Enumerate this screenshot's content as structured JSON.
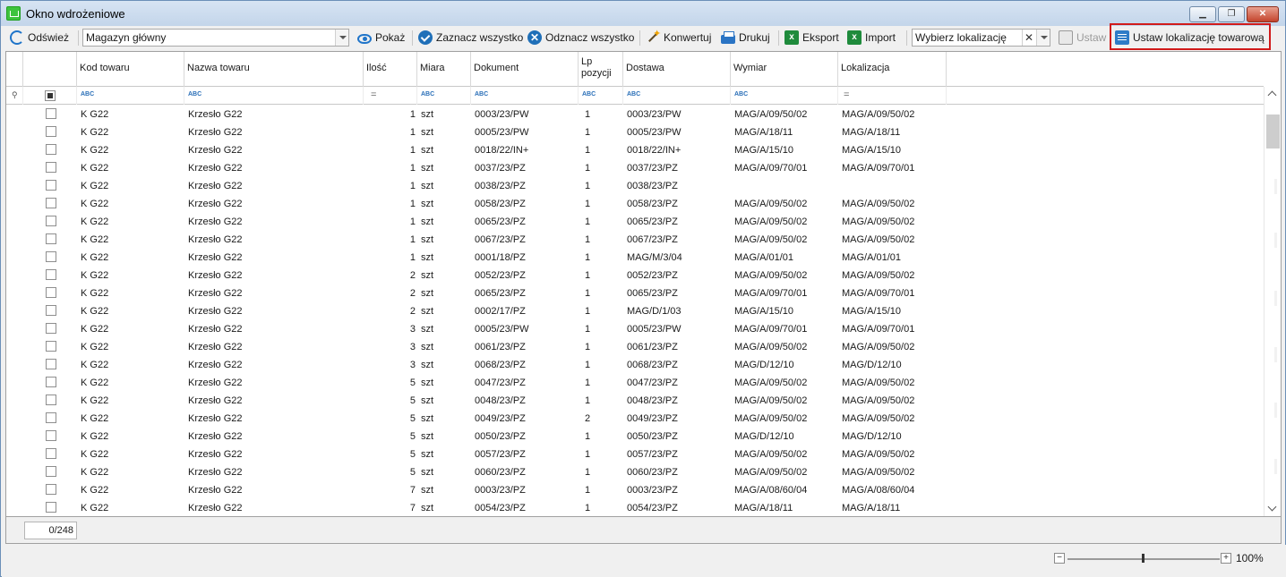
{
  "window": {
    "title": "Okno wdrożeniowe"
  },
  "toolbar": {
    "refresh_label": "Odśwież",
    "warehouse_value": "Magazyn główny",
    "show_label": "Pokaż",
    "select_all_label": "Zaznacz wszystko",
    "deselect_all_label": "Odznacz wszystko",
    "convert_label": "Konwertuj",
    "print_label": "Drukuj",
    "export_label": "Eksport",
    "import_label": "Import",
    "location_placeholder": "Wybierz lokalizację",
    "set_label": "Ustaw",
    "set_location_label": "Ustaw lokalizację towarową",
    "clear_glyph": "✕"
  },
  "grid": {
    "columns": {
      "code": "Kod towaru",
      "name": "Nazwa towaru",
      "qty": "Ilość",
      "unit": "Miara",
      "document": "Dokument",
      "lp_line1": "Lp",
      "lp_line2": "pozycji",
      "delivery": "Dostawa",
      "dimension": "Wymiar",
      "location": "Lokalizacja"
    },
    "filter_abc": "ABC",
    "filter_eq": "=",
    "rows": [
      [
        "K G22",
        "Krzesło G22",
        "1",
        "szt",
        "0003/23/PW",
        "1",
        "0003/23/PW",
        "MAG/A/09/50/02",
        "MAG/A/09/50/02"
      ],
      [
        "K G22",
        "Krzesło G22",
        "1",
        "szt",
        "0005/23/PW",
        "1",
        "0005/23/PW",
        "MAG/A/18/11",
        "MAG/A/18/11"
      ],
      [
        "K G22",
        "Krzesło G22",
        "1",
        "szt",
        "0018/22/IN+",
        "1",
        "0018/22/IN+",
        "MAG/A/15/10",
        "MAG/A/15/10"
      ],
      [
        "K G22",
        "Krzesło G22",
        "1",
        "szt",
        "0037/23/PZ",
        "1",
        "0037/23/PZ",
        "MAG/A/09/70/01",
        "MAG/A/09/70/01"
      ],
      [
        "K G22",
        "Krzesło G22",
        "1",
        "szt",
        "0038/23/PZ",
        "1",
        "0038/23/PZ",
        "",
        ""
      ],
      [
        "K G22",
        "Krzesło G22",
        "1",
        "szt",
        "0058/23/PZ",
        "1",
        "0058/23/PZ",
        "MAG/A/09/50/02",
        "MAG/A/09/50/02"
      ],
      [
        "K G22",
        "Krzesło G22",
        "1",
        "szt",
        "0065/23/PZ",
        "1",
        "0065/23/PZ",
        "MAG/A/09/50/02",
        "MAG/A/09/50/02"
      ],
      [
        "K G22",
        "Krzesło G22",
        "1",
        "szt",
        "0067/23/PZ",
        "1",
        "0067/23/PZ",
        "MAG/A/09/50/02",
        "MAG/A/09/50/02"
      ],
      [
        "K G22",
        "Krzesło G22",
        "1",
        "szt",
        "0001/18/PZ",
        "1",
        "MAG/M/3/04",
        "MAG/A/01/01",
        "MAG/A/01/01"
      ],
      [
        "K G22",
        "Krzesło G22",
        "2",
        "szt",
        "0052/23/PZ",
        "1",
        "0052/23/PZ",
        "MAG/A/09/50/02",
        "MAG/A/09/50/02"
      ],
      [
        "K G22",
        "Krzesło G22",
        "2",
        "szt",
        "0065/23/PZ",
        "1",
        "0065/23/PZ",
        "MAG/A/09/70/01",
        "MAG/A/09/70/01"
      ],
      [
        "K G22",
        "Krzesło G22",
        "2",
        "szt",
        "0002/17/PZ",
        "1",
        "MAG/D/1/03",
        "MAG/A/15/10",
        "MAG/A/15/10"
      ],
      [
        "K G22",
        "Krzesło G22",
        "3",
        "szt",
        "0005/23/PW",
        "1",
        "0005/23/PW",
        "MAG/A/09/70/01",
        "MAG/A/09/70/01"
      ],
      [
        "K G22",
        "Krzesło G22",
        "3",
        "szt",
        "0061/23/PZ",
        "1",
        "0061/23/PZ",
        "MAG/A/09/50/02",
        "MAG/A/09/50/02"
      ],
      [
        "K G22",
        "Krzesło G22",
        "3",
        "szt",
        "0068/23/PZ",
        "1",
        "0068/23/PZ",
        "MAG/D/12/10",
        "MAG/D/12/10"
      ],
      [
        "K G22",
        "Krzesło G22",
        "5",
        "szt",
        "0047/23/PZ",
        "1",
        "0047/23/PZ",
        "MAG/A/09/50/02",
        "MAG/A/09/50/02"
      ],
      [
        "K G22",
        "Krzesło G22",
        "5",
        "szt",
        "0048/23/PZ",
        "1",
        "0048/23/PZ",
        "MAG/A/09/50/02",
        "MAG/A/09/50/02"
      ],
      [
        "K G22",
        "Krzesło G22",
        "5",
        "szt",
        "0049/23/PZ",
        "2",
        "0049/23/PZ",
        "MAG/A/09/50/02",
        "MAG/A/09/50/02"
      ],
      [
        "K G22",
        "Krzesło G22",
        "5",
        "szt",
        "0050/23/PZ",
        "1",
        "0050/23/PZ",
        "MAG/D/12/10",
        "MAG/D/12/10"
      ],
      [
        "K G22",
        "Krzesło G22",
        "5",
        "szt",
        "0057/23/PZ",
        "1",
        "0057/23/PZ",
        "MAG/A/09/50/02",
        "MAG/A/09/50/02"
      ],
      [
        "K G22",
        "Krzesło G22",
        "5",
        "szt",
        "0060/23/PZ",
        "1",
        "0060/23/PZ",
        "MAG/A/09/50/02",
        "MAG/A/09/50/02"
      ],
      [
        "K G22",
        "Krzesło G22",
        "7",
        "szt",
        "0003/23/PZ",
        "1",
        "0003/23/PZ",
        "MAG/A/08/60/04",
        "MAG/A/08/60/04"
      ],
      [
        "K G22",
        "Krzesło G22",
        "7",
        "szt",
        "0054/23/PZ",
        "1",
        "0054/23/PZ",
        "MAG/A/18/11",
        "MAG/A/18/11"
      ]
    ]
  },
  "footer": {
    "counter": "0/248"
  },
  "status": {
    "zoom_minus": "−",
    "zoom_plus": "+",
    "zoom_level": "100%",
    "zoom_fraction": 0.5
  },
  "colors": {
    "accent_blue": "#1f74c9",
    "highlight_red": "#d11a1a",
    "excel_green": "#1f8b3c"
  }
}
